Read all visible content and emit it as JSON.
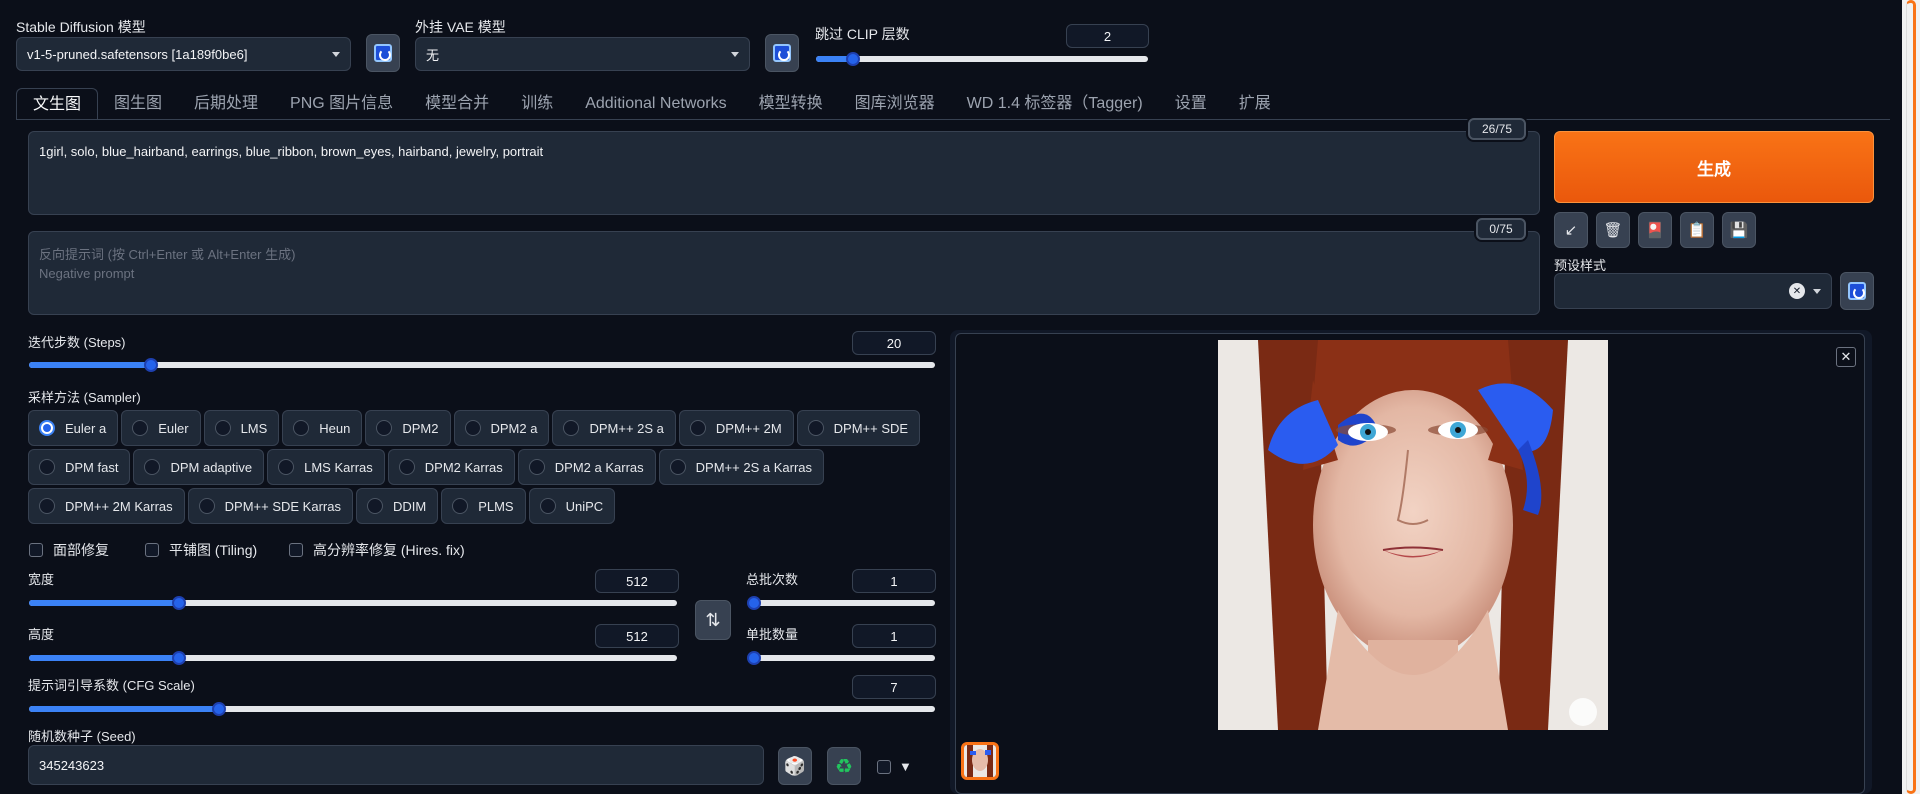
{
  "header": {
    "sd_model_label": "Stable Diffusion 模型",
    "sd_model_value": "v1-5-pruned.safetensors [1a189f0be6]",
    "vae_label": "外挂 VAE 模型",
    "vae_value": "无",
    "clip_label": "跳过 CLIP 层数",
    "clip_value": "2",
    "clip_fraction": 0.11
  },
  "tabs": [
    {
      "label": "文生图"
    },
    {
      "label": "图生图"
    },
    {
      "label": "后期处理"
    },
    {
      "label": "PNG 图片信息"
    },
    {
      "label": "模型合并"
    },
    {
      "label": "训练"
    },
    {
      "label": "Additional Networks"
    },
    {
      "label": "模型转换"
    },
    {
      "label": "图库浏览器"
    },
    {
      "label": "WD 1.4 标签器（Tagger)"
    },
    {
      "label": "设置"
    },
    {
      "label": "扩展"
    }
  ],
  "prompt": {
    "text": "1girl, solo, blue_hairband, earrings, blue_ribbon, brown_eyes, hairband, jewelry, portrait",
    "token_count": "26/75"
  },
  "negative_prompt": {
    "placeholder_line1": "反向提示词 (按 Ctrl+Enter 或 Alt+Enter 生成)",
    "placeholder_line2": "Negative prompt",
    "token_count": "0/75"
  },
  "actions": {
    "generate_label": "生成",
    "preset_label": "预设样式",
    "tools": [
      {
        "icon": "arrow-icon",
        "glyph": "↙"
      },
      {
        "icon": "trash-icon",
        "glyph": "🗑"
      },
      {
        "icon": "card-icon",
        "glyph": "🎴"
      },
      {
        "icon": "clipboard-icon",
        "glyph": "📋"
      },
      {
        "icon": "save-icon",
        "glyph": "💾"
      }
    ],
    "clear_glyph": "✕"
  },
  "steps": {
    "label": "迭代步数 (Steps)",
    "value": "20",
    "fraction": 0.135
  },
  "sampler": {
    "label": "采样方法 (Sampler)",
    "rows": [
      [
        "Euler a",
        "Euler",
        "LMS",
        "Heun",
        "DPM2",
        "DPM2 a",
        "DPM++ 2S a",
        "DPM++ 2M",
        "DPM++ SDE"
      ],
      [
        "DPM fast",
        "DPM adaptive",
        "LMS Karras",
        "DPM2 Karras",
        "DPM2 a Karras",
        "DPM++ 2S a Karras"
      ],
      [
        "DPM++ 2M Karras",
        "DPM++ SDE Karras",
        "DDIM",
        "PLMS",
        "UniPC"
      ]
    ],
    "selected": "Euler a"
  },
  "options": {
    "face_restore": "面部修复",
    "tiling": "平铺图 (Tiling)",
    "hires": "高分辨率修复 (Hires. fix)"
  },
  "size": {
    "width_label": "宽度",
    "width_value": "512",
    "width_fraction": 0.232,
    "height_label": "高度",
    "height_value": "512",
    "height_fraction": 0.232,
    "swap_glyph": "⇅",
    "batch_count_label": "总批次数",
    "batch_count_value": "1",
    "batch_count_fraction": 0.0,
    "batch_size_label": "单批数量",
    "batch_size_value": "1",
    "batch_size_fraction": 0.0
  },
  "cfg": {
    "label": "提示词引导系数 (CFG Scale)",
    "value": "7",
    "fraction": 0.21
  },
  "seed": {
    "label": "随机数种子 (Seed)",
    "value": "345243623",
    "dice_glyph": "🎲",
    "recycle_glyph": "♻",
    "extra_glyph": "▼"
  },
  "output": {
    "close_glyph": "✕"
  },
  "colors": {
    "accent": "#3b82f6",
    "generate": "#f97316",
    "background": "#0b0f19"
  }
}
